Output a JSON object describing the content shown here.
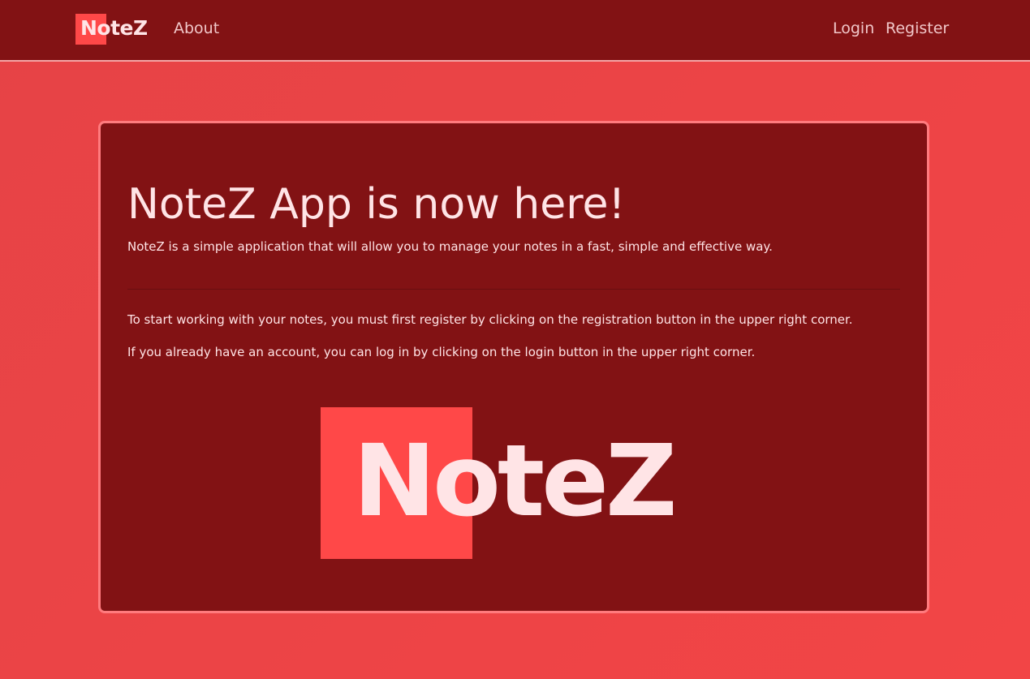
{
  "navbar": {
    "logo_text": "NoteZ",
    "about_label": "About",
    "login_label": "Login",
    "register_label": "Register"
  },
  "hero": {
    "title": "NoteZ App is now here!",
    "lead": "NoteZ is a simple application that will allow you to manage your notes in a fast, simple and effective way.",
    "paragraph_1": "To start working with your notes, you must first register by clicking on the registration button in the upper right corner.",
    "paragraph_2": "If you already have an account, you can log in by clicking on the login button in the upper right corner.",
    "logo_text": "NoteZ"
  },
  "colors": {
    "page_background": "#f04546",
    "navbar_background": "#821214",
    "card_background": "#821214",
    "card_border": "#ff7b7e",
    "logo_accent": "#ff4848",
    "text": "#ffe4e6"
  }
}
